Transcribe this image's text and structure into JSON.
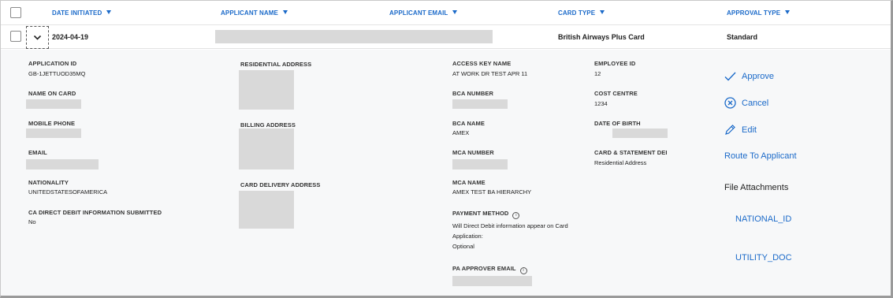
{
  "header": {
    "columns": [
      "DATE INITIATED",
      "APPLICANT NAME",
      "APPLICANT EMAIL",
      "CARD TYPE",
      "APPROVAL TYPE"
    ]
  },
  "row": {
    "date": "2024-04-19",
    "card_type": "British Airways Plus Card",
    "approval_type": "Standard"
  },
  "details": {
    "col1": {
      "application_id_label": "APPLICATION ID",
      "application_id": "GB-1JETTUOD35MQ",
      "name_on_card_label": "NAME ON CARD",
      "mobile_phone_label": "MOBILE PHONE",
      "email_label": "EMAIL",
      "nationality_label": "NATIONALITY",
      "nationality": "UNITEDSTATESOFAMERICA",
      "ca_direct_debit_label": "CA DIRECT DEBIT INFORMATION SUBMITTED",
      "ca_direct_debit": "No"
    },
    "col2": {
      "residential_address_label": "RESIDENTIAL ADDRESS",
      "billing_address_label": "BILLING ADDRESS",
      "card_delivery_address_label": "CARD DELIVERY ADDRESS"
    },
    "col3": {
      "access_key_name_label": "ACCESS KEY NAME",
      "access_key_name": "AT WORK DR TEST APR 11",
      "bca_number_label": "BCA NUMBER",
      "bca_name_label": "BCA NAME",
      "bca_name": "AMEX",
      "mca_number_label": "MCA NUMBER",
      "mca_name_label": "MCA NAME",
      "mca_name": "AMEX TEST BA HIERARCHY",
      "payment_method_label": "PAYMENT METHOD",
      "payment_method_line1": "Will Direct Debit information appear on Card",
      "payment_method_line2": "Application:",
      "payment_method_line3": "Optional",
      "pa_approver_email_label": "PA APPROVER EMAIL",
      "info_glyph": "i"
    },
    "col4": {
      "employee_id_label": "EMPLOYEE ID",
      "employee_id": "12",
      "cost_centre_label": "COST CENTRE",
      "cost_centre": "1234",
      "date_of_birth_label": "DATE OF BIRTH",
      "card_statement_label": "CARD & STATEMENT DEI",
      "card_statement": "Residential Address"
    }
  },
  "actions": {
    "approve": "Approve",
    "cancel": "Cancel",
    "edit": "Edit",
    "route": "Route To Applicant",
    "attachments_title": "File Attachments",
    "attachments": [
      "NATIONAL_ID",
      "UTILITY_DOC"
    ]
  },
  "colors": {
    "accent": "#1b6ac9",
    "redaction": "#d9d9d9",
    "panel": "#f7f8f9"
  }
}
